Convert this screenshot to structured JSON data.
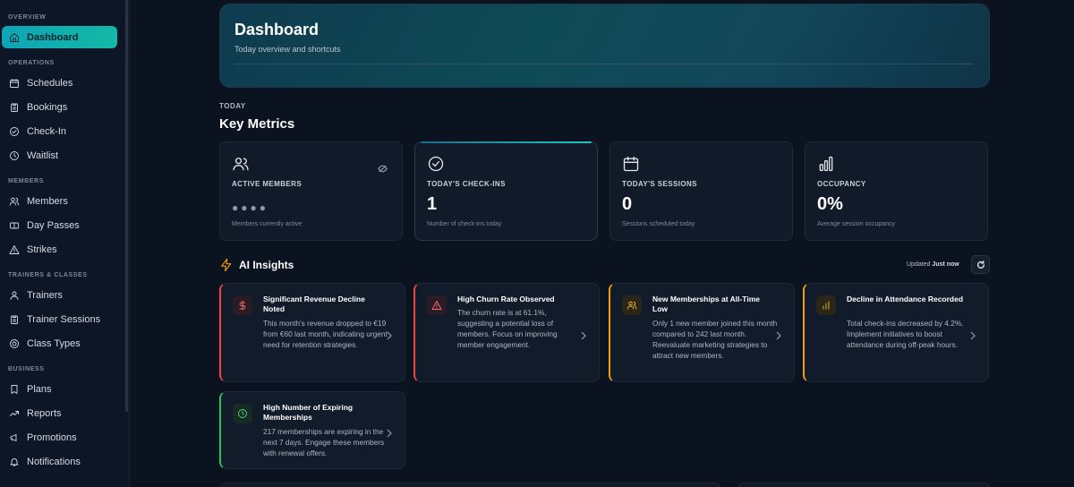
{
  "sidebar": {
    "sections": [
      {
        "title": "OVERVIEW",
        "items": [
          {
            "label": "Dashboard",
            "icon": "home-icon",
            "active": true
          }
        ]
      },
      {
        "title": "OPERATIONS",
        "items": [
          {
            "label": "Schedules",
            "icon": "calendar-icon"
          },
          {
            "label": "Bookings",
            "icon": "clipboard-icon"
          },
          {
            "label": "Check-In",
            "icon": "check-circle-icon"
          },
          {
            "label": "Waitlist",
            "icon": "clock-icon"
          }
        ]
      },
      {
        "title": "MEMBERS",
        "items": [
          {
            "label": "Members",
            "icon": "users-icon"
          },
          {
            "label": "Day Passes",
            "icon": "ticket-icon"
          },
          {
            "label": "Strikes",
            "icon": "warning-icon"
          }
        ]
      },
      {
        "title": "TRAINERS & CLASSES",
        "items": [
          {
            "label": "Trainers",
            "icon": "user-icon"
          },
          {
            "label": "Trainer Sessions",
            "icon": "clipboard-icon"
          },
          {
            "label": "Class Types",
            "icon": "target-icon"
          }
        ]
      },
      {
        "title": "BUSINESS",
        "items": [
          {
            "label": "Plans",
            "icon": "bookmark-icon"
          },
          {
            "label": "Reports",
            "icon": "trend-icon"
          },
          {
            "label": "Promotions",
            "icon": "megaphone-icon"
          },
          {
            "label": "Notifications",
            "icon": "bell-icon"
          }
        ]
      }
    ]
  },
  "header": {
    "title": "Dashboard",
    "subtitle": "Today overview and shortcuts"
  },
  "metrics_section": {
    "eyebrow": "TODAY",
    "title": "Key Metrics",
    "cards": [
      {
        "icon": "users-icon",
        "label": "ACTIVE MEMBERS",
        "value": "●●●●",
        "hidden": true,
        "help": "Members currently active"
      },
      {
        "icon": "check-circle-icon",
        "label": "TODAY'S CHECK-INS",
        "value": "1",
        "help": "Number of check-ins today",
        "highlight": true
      },
      {
        "icon": "calendar-icon",
        "label": "TODAY'S SESSIONS",
        "value": "0",
        "help": "Sessions scheduled today"
      },
      {
        "icon": "bar-chart-icon",
        "label": "OCCUPANCY",
        "value": "0%",
        "help": "Average session occupancy"
      }
    ]
  },
  "ai_insights": {
    "title": "AI Insights",
    "updated_prefix": "Updated ",
    "updated_value": "Just now",
    "cards": [
      {
        "title": "Significant Revenue Decline Noted",
        "body": "This month's revenue dropped to €19 from €60 last month, indicating urgent need for retention strategies.",
        "icon": "dollar-icon",
        "accent": "#ef4444",
        "tone": "red"
      },
      {
        "title": "High Churn Rate Observed",
        "body": "The churn rate is at 61.1%, suggesting a potential loss of members. Focus on improving member engagement.",
        "icon": "warning-icon",
        "accent": "#ef4444",
        "tone": "red"
      },
      {
        "title": "New Memberships at All-Time Low",
        "body": "Only 1 new member joined this month compared to 242 last month. Reevaluate marketing strategies to attract new members.",
        "icon": "users-icon",
        "accent": "#f59e0b",
        "tone": "amber"
      },
      {
        "title": "Decline in Attendance Recorded",
        "body": "Total check-ins decreased by 4.2%. Implement initiatives to boost attendance during off-peak hours.",
        "icon": "bar-chart-icon",
        "accent": "#f59e0b",
        "tone": "amber"
      },
      {
        "title": "High Number of Expiring Memberships",
        "body": "217 memberships are expiring in the next 7 days. Engage these members with renewal offers.",
        "icon": "clock-icon",
        "accent": "#22c55e",
        "tone": "green"
      }
    ]
  }
}
